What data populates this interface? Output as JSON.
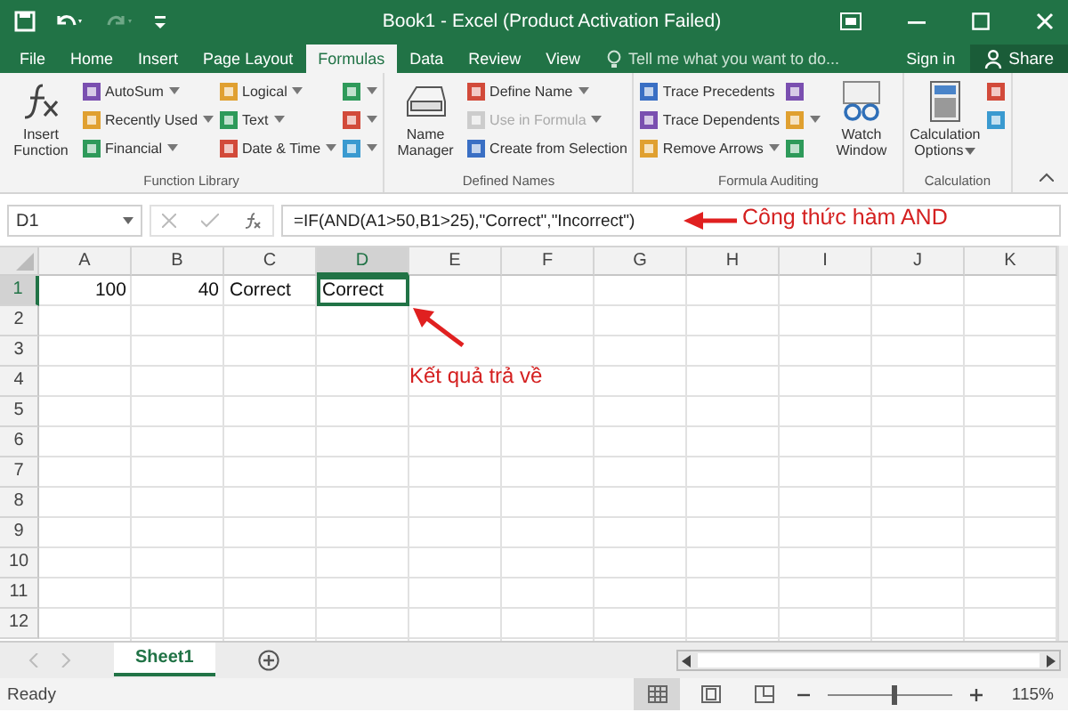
{
  "window": {
    "title": "Book1 - Excel (Product Activation Failed)"
  },
  "tabs": [
    {
      "label": "File",
      "selected": false
    },
    {
      "label": "Home",
      "selected": false
    },
    {
      "label": "Insert",
      "selected": false
    },
    {
      "label": "Page Layout",
      "selected": false
    },
    {
      "label": "Formulas",
      "selected": true
    },
    {
      "label": "Data",
      "selected": false
    },
    {
      "label": "Review",
      "selected": false
    },
    {
      "label": "View",
      "selected": false
    }
  ],
  "tell_me": {
    "placeholder": "Tell me what you want to do..."
  },
  "account": {
    "sign_in": "Sign in",
    "share": "Share"
  },
  "ribbon_groups": [
    {
      "label": "Function Library",
      "columns": [
        {
          "kind": "large",
          "label": "Insert Function",
          "dropdown": false
        },
        {
          "kind": "stack",
          "items": [
            {
              "label": "AutoSum",
              "dropdown": true,
              "disabled": false
            },
            {
              "label": "Recently Used",
              "dropdown": true,
              "disabled": false
            },
            {
              "label": "Financial",
              "dropdown": true,
              "disabled": false
            }
          ]
        },
        {
          "kind": "stack",
          "items": [
            {
              "label": "Logical",
              "dropdown": true,
              "disabled": false
            },
            {
              "label": "Text",
              "dropdown": true,
              "disabled": false
            },
            {
              "label": "Date & Time",
              "dropdown": true,
              "disabled": false
            }
          ]
        },
        {
          "kind": "stack",
          "items": [
            {
              "dropdown": true,
              "disabled": false
            },
            {
              "dropdown": true,
              "disabled": false
            },
            {
              "dropdown": true,
              "disabled": false
            }
          ]
        }
      ]
    },
    {
      "label": "Defined Names",
      "columns": [
        {
          "kind": "large",
          "label": "Name Manager",
          "dropdown": false
        },
        {
          "kind": "stack",
          "items": [
            {
              "label": "Define Name",
              "dropdown": true,
              "disabled": false
            },
            {
              "label": "Use in Formula",
              "dropdown": true,
              "disabled": true
            },
            {
              "label": "Create from Selection",
              "dropdown": false,
              "disabled": false
            }
          ]
        }
      ]
    },
    {
      "label": "Formula Auditing",
      "columns": [
        {
          "kind": "stack",
          "items": [
            {
              "label": "Trace Precedents",
              "dropdown": false,
              "disabled": false
            },
            {
              "label": "Trace Dependents",
              "dropdown": false,
              "disabled": false
            },
            {
              "label": "Remove Arrows",
              "dropdown": true,
              "disabled": false
            }
          ]
        },
        {
          "kind": "stack",
          "items": [
            {
              "dropdown": false,
              "disabled": false
            },
            {
              "dropdown": true,
              "disabled": false
            },
            {
              "dropdown": false,
              "disabled": false
            }
          ]
        },
        {
          "kind": "large",
          "label": "Watch Window",
          "dropdown": false
        }
      ]
    },
    {
      "label": "Calculation",
      "columns": [
        {
          "kind": "large",
          "label": "Calculation Options",
          "dropdown": true
        },
        {
          "kind": "stack",
          "items": [
            {
              "dropdown": false,
              "disabled": false
            },
            {
              "dropdown": false,
              "disabled": false
            }
          ]
        }
      ]
    }
  ],
  "formula_bar": {
    "name_box": "D1",
    "formula": "=IF(AND(A1>50,B1>25),\"Correct\",\"Incorrect\")"
  },
  "columns": [
    {
      "label": "A",
      "selected": false
    },
    {
      "label": "B",
      "selected": false
    },
    {
      "label": "C",
      "selected": false
    },
    {
      "label": "D",
      "selected": true
    },
    {
      "label": "E",
      "selected": false
    },
    {
      "label": "F",
      "selected": false
    },
    {
      "label": "G",
      "selected": false
    },
    {
      "label": "H",
      "selected": false
    },
    {
      "label": "I",
      "selected": false
    },
    {
      "label": "J",
      "selected": false
    },
    {
      "label": "K",
      "selected": false
    }
  ],
  "rows": [
    {
      "label": "1",
      "selected": true,
      "cells": [
        {
          "text": "100",
          "kind": "number",
          "selected": false
        },
        {
          "text": "40",
          "kind": "number",
          "selected": false
        },
        {
          "text": "Correct",
          "kind": "text",
          "selected": false
        },
        {
          "text": "Correct",
          "kind": "text",
          "selected": true
        }
      ]
    },
    {
      "label": "2",
      "selected": false
    },
    {
      "label": "3",
      "selected": false
    },
    {
      "label": "4",
      "selected": false
    },
    {
      "label": "5",
      "selected": false
    },
    {
      "label": "6",
      "selected": false
    },
    {
      "label": "7",
      "selected": false
    },
    {
      "label": "8",
      "selected": false
    },
    {
      "label": "9",
      "selected": false
    },
    {
      "label": "10",
      "selected": false
    },
    {
      "label": "11",
      "selected": false
    },
    {
      "label": "12",
      "selected": false
    }
  ],
  "annotations": [
    {
      "text": "Công thức hàm AND"
    },
    {
      "text": "Kết quả trả về"
    }
  ],
  "sheet_tabs": [
    {
      "label": "Sheet1",
      "selected": true
    }
  ],
  "status_bar": {
    "text": "Ready",
    "views": [
      {
        "selected": true
      },
      {
        "selected": false
      },
      {
        "selected": false
      }
    ],
    "zoom": {
      "level": 0.52,
      "reading": "115%"
    }
  }
}
